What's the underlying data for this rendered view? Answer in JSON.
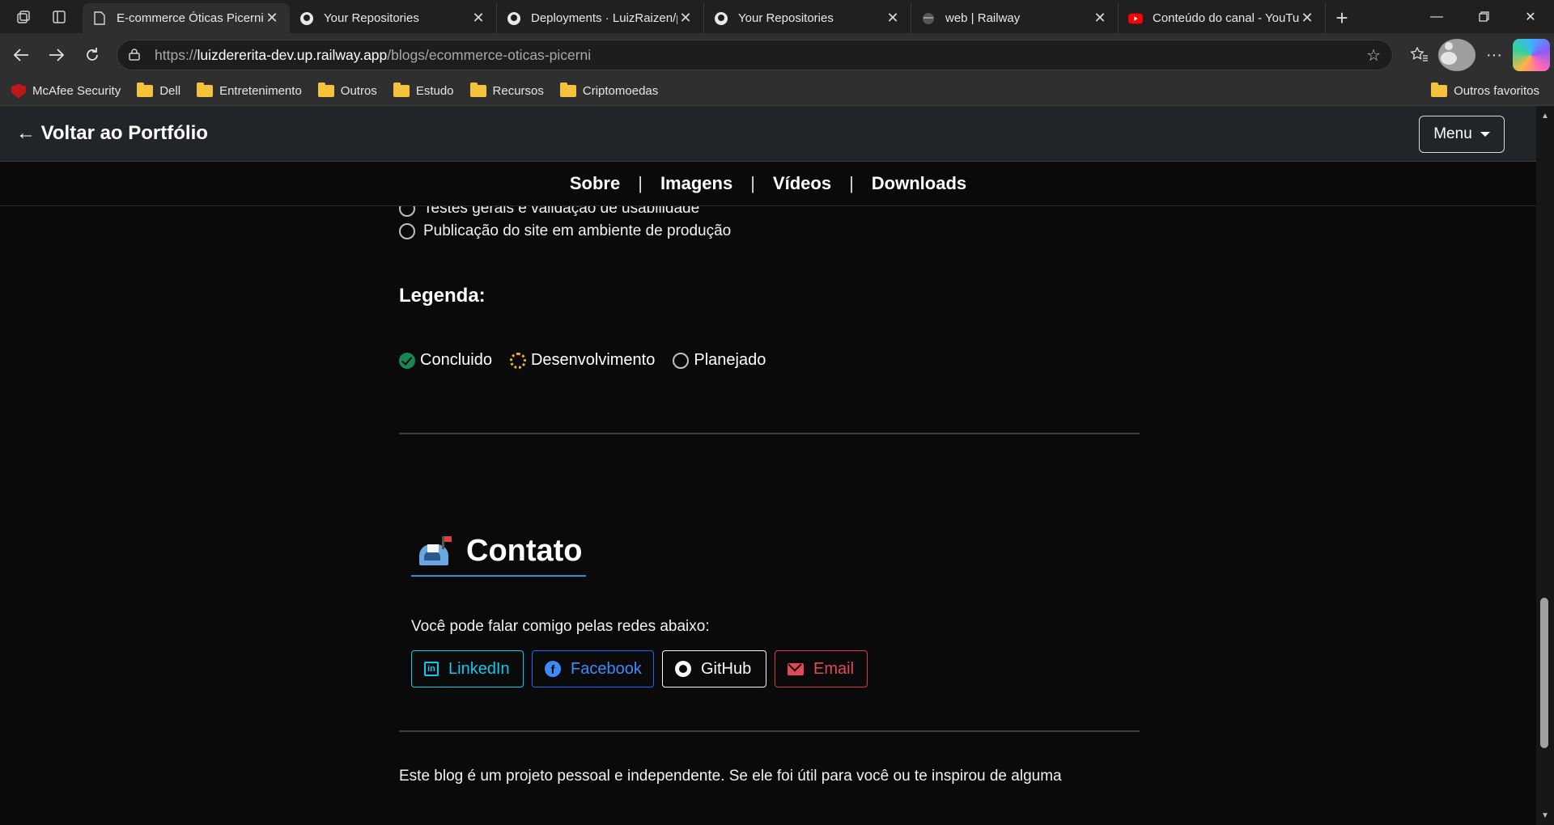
{
  "browser": {
    "tabs": [
      {
        "title": "E-commerce Óticas Picerni",
        "icon": "page-icon",
        "active": true
      },
      {
        "title": "Your Repositories",
        "icon": "github-icon",
        "active": false
      },
      {
        "title": "Deployments · LuizRaizen/p",
        "icon": "github-icon",
        "active": false
      },
      {
        "title": "Your Repositories",
        "icon": "github-icon",
        "active": false
      },
      {
        "title": "web | Railway",
        "icon": "railway-icon",
        "active": false
      },
      {
        "title": "Conteúdo do canal - YouTu",
        "icon": "youtube-icon",
        "active": false
      }
    ],
    "url": {
      "scheme": "https://",
      "host": "luizdererita-dev.up.railway.app",
      "path": "/blogs/ecommerce-oticas-picerni"
    },
    "bookmarks": [
      {
        "label": "McAfee Security",
        "icon": "mcafee-icon"
      },
      {
        "label": "Dell",
        "icon": "folder-icon"
      },
      {
        "label": "Entretenimento",
        "icon": "folder-icon"
      },
      {
        "label": "Outros",
        "icon": "folder-icon"
      },
      {
        "label": "Estudo",
        "icon": "folder-icon"
      },
      {
        "label": "Recursos",
        "icon": "folder-icon"
      },
      {
        "label": "Criptomoedas",
        "icon": "folder-icon"
      }
    ],
    "other_favorites": "Outros favoritos"
  },
  "page": {
    "back_link": "← Voltar ao Portfólio",
    "menu_label": "Menu",
    "subnav": [
      "Sobre",
      "Imagens",
      "Vídeos",
      "Downloads"
    ],
    "subnav_sep": "|",
    "checklist_cut": "Testes gerais e validação de usabilidade",
    "checklist_last": "Publicação do site em ambiente de produção",
    "legend_title": "Legenda:",
    "legend": {
      "done": "Concluido",
      "dev": "Desenvolvimento",
      "planned": "Planejado"
    },
    "contact_title": "Contato",
    "contact_text": "Você pode falar comigo pelas redes abaixo:",
    "social": {
      "linkedin": "LinkedIn",
      "facebook": "Facebook",
      "github": "GitHub",
      "email": "Email"
    },
    "footer_text": "Este blog é um projeto pessoal e independente. Se ele foi útil para você ou te inspirou de alguma"
  },
  "colors": {
    "accent_blue": "#2d8fe0",
    "success": "#198754",
    "warning": "#f0b429",
    "linkedin": "#0dcaf0",
    "facebook": "#0d6efd",
    "email": "#dc3545"
  }
}
